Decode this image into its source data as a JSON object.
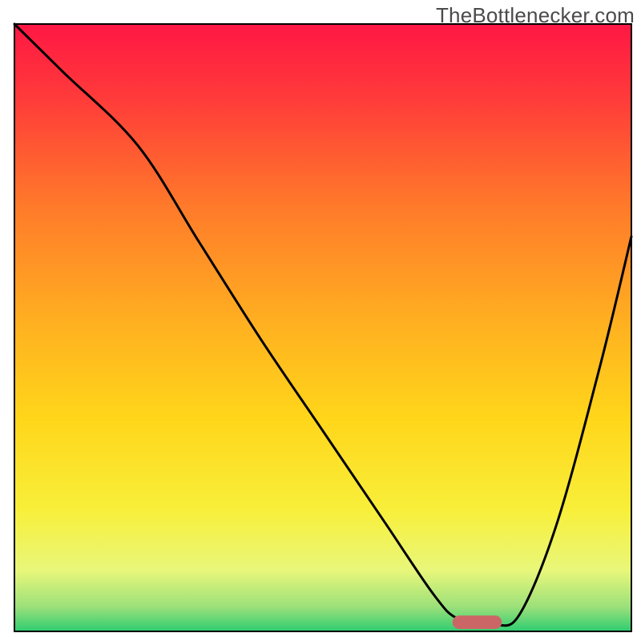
{
  "watermark": "TheBottlenecker.com",
  "chart_data": {
    "type": "line",
    "title": "",
    "xlabel": "",
    "ylabel": "",
    "xlim": [
      0,
      100
    ],
    "ylim": [
      0,
      100
    ],
    "grid": false,
    "background": {
      "type": "vertical-gradient",
      "stops": [
        {
          "pos": 0.0,
          "color": "#ff1744"
        },
        {
          "pos": 0.12,
          "color": "#ff3a3a"
        },
        {
          "pos": 0.3,
          "color": "#ff7a2a"
        },
        {
          "pos": 0.5,
          "color": "#ffb220"
        },
        {
          "pos": 0.65,
          "color": "#ffd61a"
        },
        {
          "pos": 0.8,
          "color": "#f8ef3a"
        },
        {
          "pos": 0.9,
          "color": "#e8f77a"
        },
        {
          "pos": 0.96,
          "color": "#9be07a"
        },
        {
          "pos": 1.0,
          "color": "#2ecc71"
        }
      ]
    },
    "series": [
      {
        "name": "bottleneck-curve",
        "x": [
          0,
          8,
          20,
          30,
          40,
          50,
          60,
          68,
          72,
          78,
          82,
          88,
          95,
          100
        ],
        "y": [
          100,
          92,
          80,
          64,
          48,
          33,
          18,
          6,
          2,
          1,
          3,
          18,
          44,
          65
        ]
      }
    ],
    "marker": {
      "name": "optimal-range-pill",
      "x_center": 75,
      "y_center": 1.5,
      "width": 8,
      "height": 2.2,
      "color": "#cc6666"
    }
  }
}
